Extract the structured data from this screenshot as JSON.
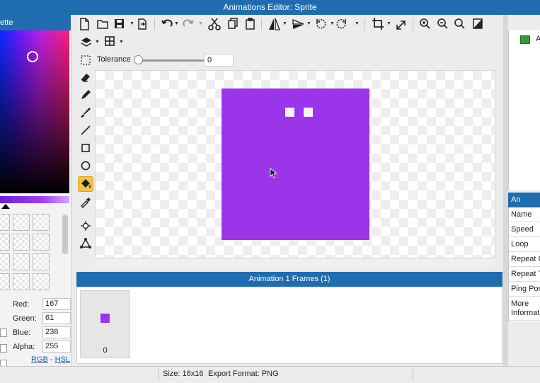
{
  "window": {
    "title": "Animations Editor: Sprite"
  },
  "palette": {
    "header": "ette",
    "selected_hex": "#a73dee",
    "red_label": "Red:",
    "red_value": "167",
    "green_label": "Green:",
    "green_value": "61",
    "blue_label": "Blue:",
    "blue_value": "238",
    "alpha_label": "Alpha:",
    "alpha_value": "255",
    "mode_rgb": "RGB",
    "mode_sep": " - ",
    "mode_hsl": "HSL"
  },
  "toolbar": {
    "icons": [
      "new-file-icon",
      "open-folder-icon",
      "save-icon",
      "export-icon",
      "undo-icon",
      "redo-icon",
      "cut-icon",
      "copy-icon",
      "paste-icon",
      "flip-horizontal-icon",
      "flip-vertical-icon",
      "rotate-left-icon",
      "rotate-right-icon",
      "crop-icon",
      "resize-icon",
      "zoom-in-icon",
      "zoom-out-icon",
      "zoom-fit-icon",
      "transparency-icon",
      "layers-icon",
      "grid-icon"
    ]
  },
  "tolerance": {
    "label": "Tolerance",
    "value": "0",
    "level": 0
  },
  "tools": [
    "selection-icon",
    "eraser-icon",
    "pencil-icon",
    "brush-icon",
    "line-icon",
    "rectangle-icon",
    "ellipse-icon",
    "fill-bucket-icon",
    "eyedropper-icon",
    "pivot-icon",
    "path-icon"
  ],
  "active_tool": "fill-bucket-icon",
  "canvas": {
    "sprite_color": "#9b35ea",
    "eye_color": "#f6f2fb"
  },
  "frames": {
    "header": "Animation 1 Frames (1)",
    "items": [
      {
        "label": "0"
      }
    ]
  },
  "animations": {
    "items": [
      {
        "label": "A"
      }
    ]
  },
  "properties": {
    "header": "An",
    "rows": [
      "Name",
      "Speed",
      "Loop",
      "Repeat C",
      "Repeat T",
      "Ping Pon",
      "More Informati"
    ]
  },
  "status": {
    "size": "Size: 16x16",
    "format": "Export Format: PNG"
  }
}
